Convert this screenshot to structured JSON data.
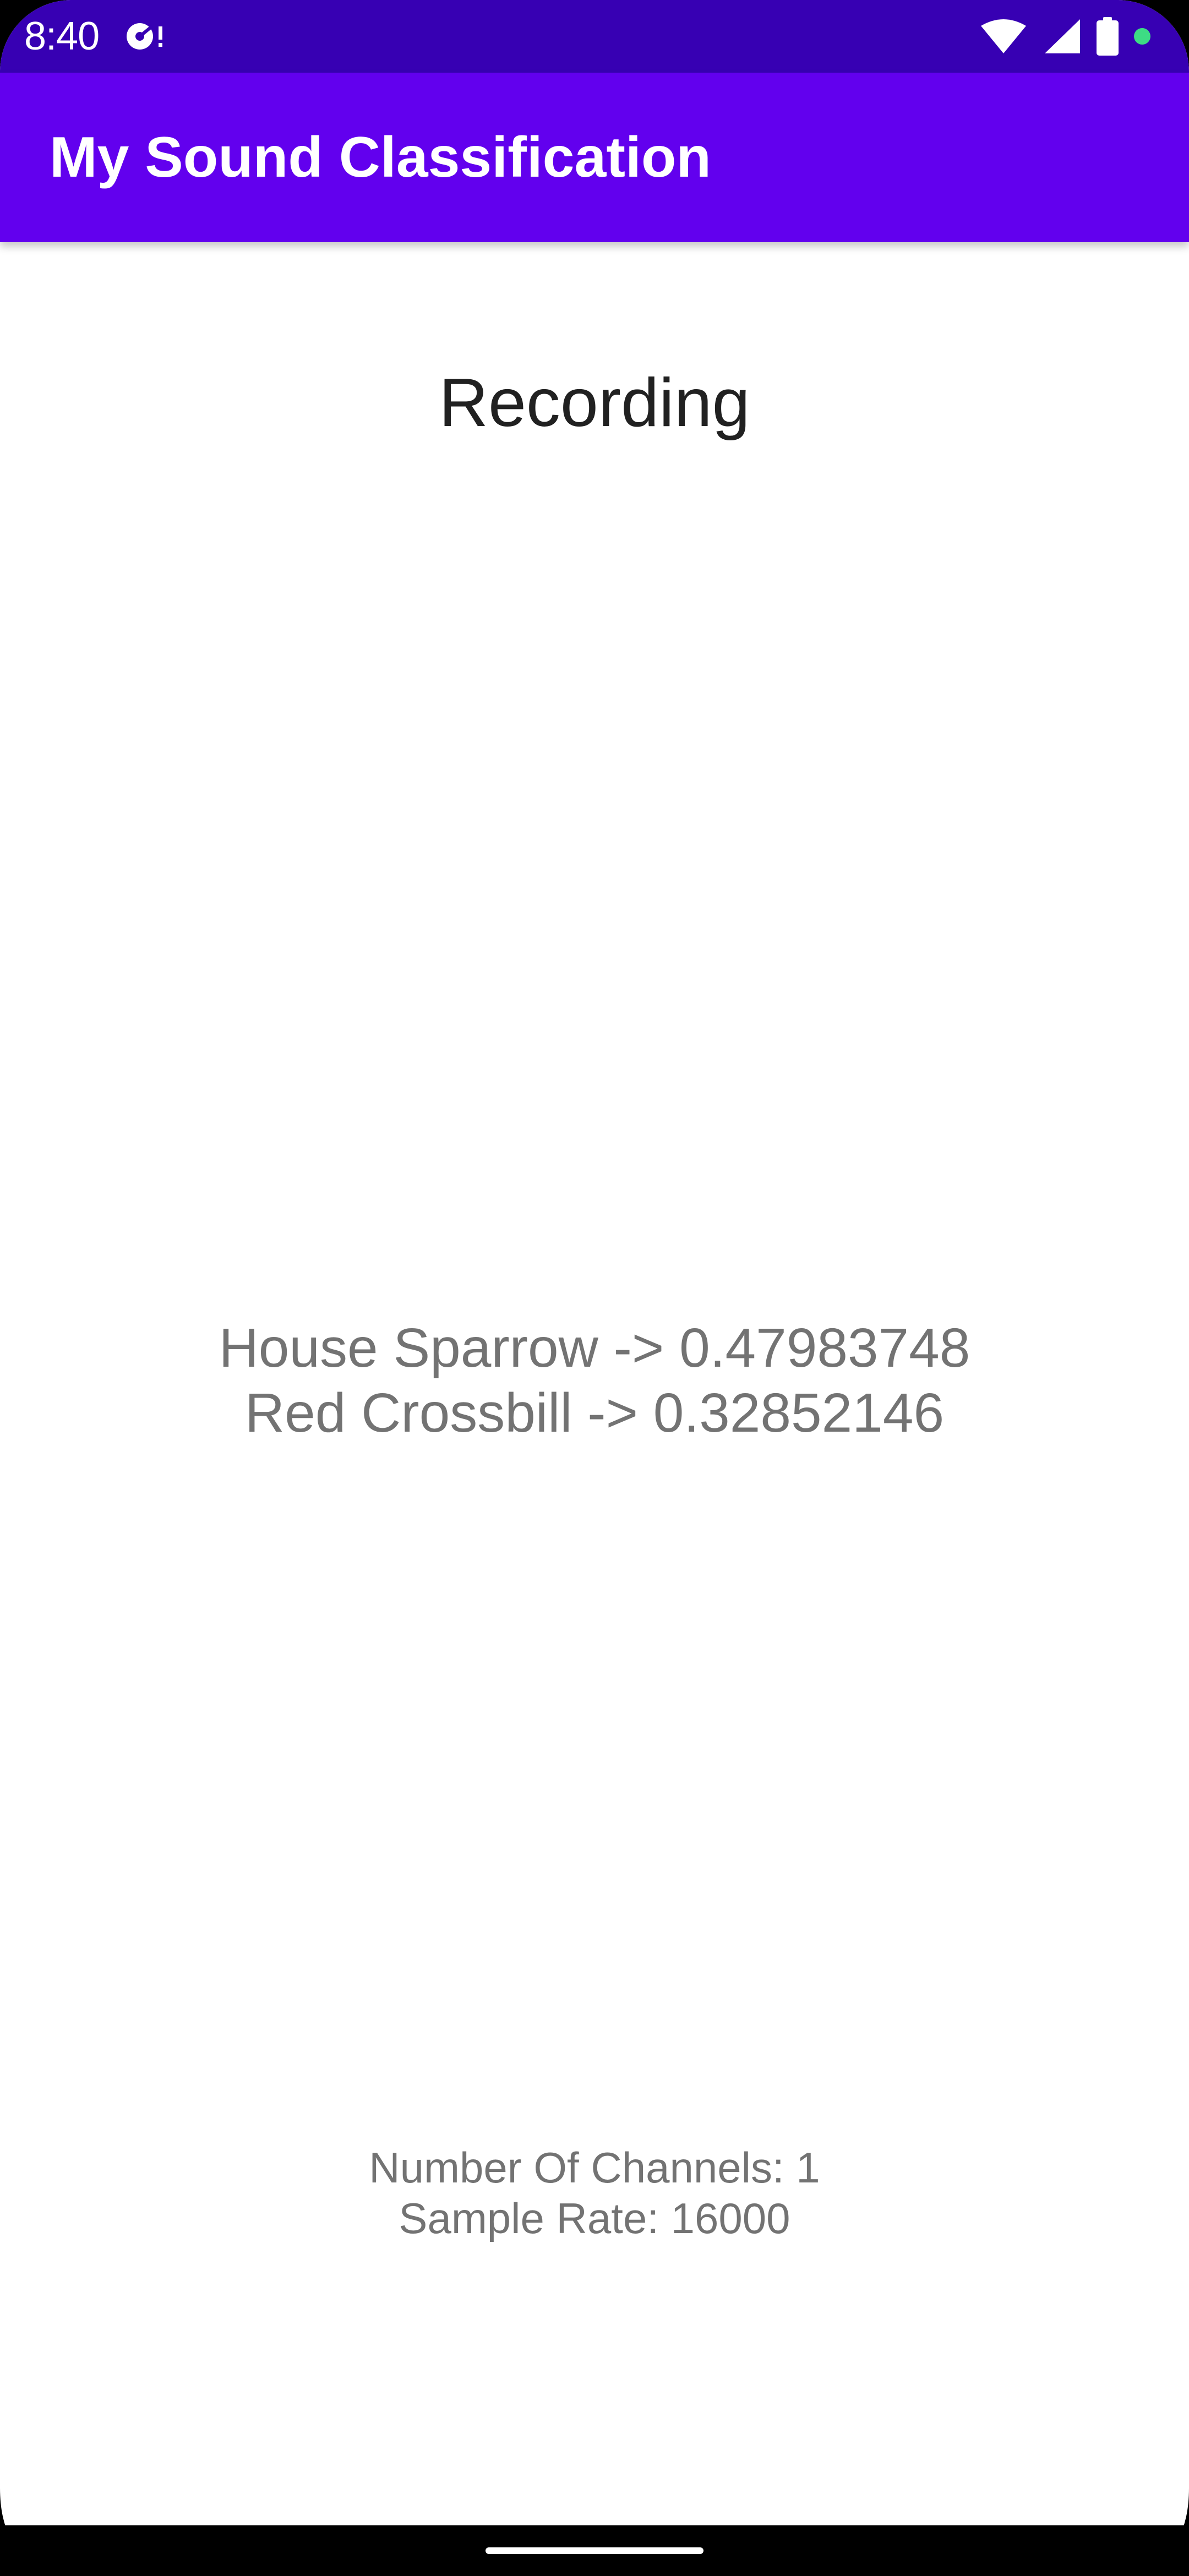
{
  "status_bar": {
    "time": "8:40",
    "icons": [
      "notification-icon",
      "wifi-icon",
      "signal-icon",
      "battery-icon",
      "privacy-indicator-dot"
    ],
    "background": "#3700b3",
    "privacy_dot_color": "#3ddc84"
  },
  "app_bar": {
    "title": "My Sound Classification",
    "background": "#6200ee"
  },
  "main": {
    "recording_label": "Recording",
    "results": [
      {
        "text": "House Sparrow -> 0.47983748"
      },
      {
        "text": "Red Crossbill -> 0.32852146"
      }
    ],
    "audio_info": {
      "channels_text": "Number Of Channels: 1",
      "sample_rate_text": "Sample Rate: 16000"
    }
  }
}
